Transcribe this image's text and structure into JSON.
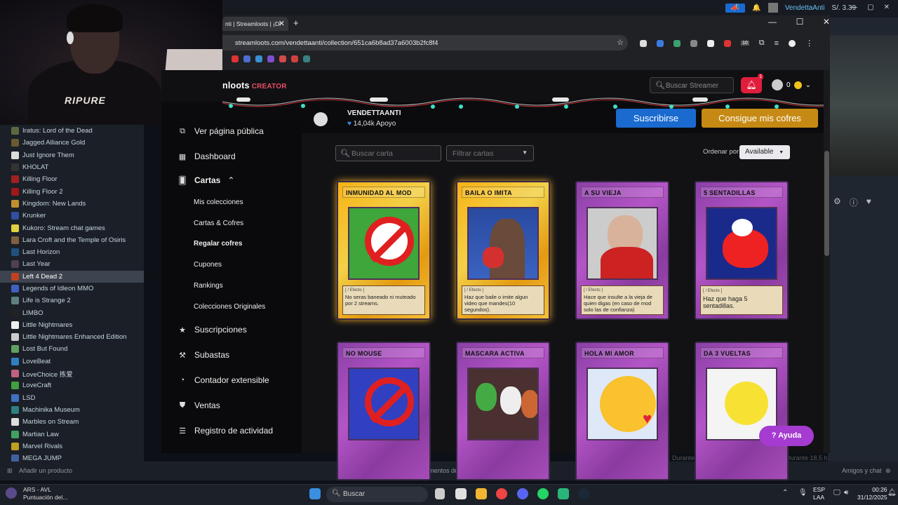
{
  "steam": {
    "username": "VendettaAnti",
    "balance": "S/. 3.39",
    "games": [
      {
        "name": "Iratus: Lord of the Dead",
        "color": "#5a6a40"
      },
      {
        "name": "Jagged Alliance Gold",
        "color": "#6a5a30"
      },
      {
        "name": "Just Ignore Them",
        "color": "#ddd"
      },
      {
        "name": "KHOLAT",
        "color": "#333"
      },
      {
        "name": "Killing Floor",
        "color": "#a02020"
      },
      {
        "name": "Killing Floor 2",
        "color": "#a01818"
      },
      {
        "name": "Kingdom: New Lands",
        "color": "#c09030"
      },
      {
        "name": "Krunker",
        "color": "#3050a0"
      },
      {
        "name": "Kukoro: Stream chat games",
        "color": "#e0d040"
      },
      {
        "name": "Lara Croft and the Temple of Osiris",
        "color": "#806040"
      },
      {
        "name": "Last Horizon",
        "color": "#205080"
      },
      {
        "name": "Last Year",
        "color": "#504050"
      },
      {
        "name": "Left 4 Dead 2",
        "color": "#c04020"
      },
      {
        "name": "Legends of Idleon MMO",
        "color": "#4060c0"
      },
      {
        "name": "Life is Strange 2",
        "color": "#608080"
      },
      {
        "name": "LIMBO",
        "color": "#222"
      },
      {
        "name": "Little Nightmares",
        "color": "#eee"
      },
      {
        "name": "Little Nightmares Enhanced Edition",
        "color": "#ccc"
      },
      {
        "name": "Lost But Found",
        "color": "#60a060"
      },
      {
        "name": "LoveBeat",
        "color": "#3080c0"
      },
      {
        "name": "LoveChoice 拣爱",
        "color": "#c06080"
      },
      {
        "name": "LoveCraft",
        "color": "#40a040"
      },
      {
        "name": "LSD",
        "color": "#4070c0"
      },
      {
        "name": "Machinika Museum",
        "color": "#308080"
      },
      {
        "name": "Marbles on Stream",
        "color": "#ddd"
      },
      {
        "name": "Martian Law",
        "color": "#40a060"
      },
      {
        "name": "Marvel Rivals",
        "color": "#c0a020"
      },
      {
        "name": "MEGA JUMP",
        "color": "#4060a0"
      }
    ],
    "add_product": "Añadir un producto",
    "downloads": "Elementos descargados - 1 de 1",
    "friends_chat": "Amigos y chat",
    "duration_1": "Durante 22,3 h",
    "duration_2": "Durante 18,5 h"
  },
  "browser": {
    "tab_title": "nti | Streamloots | ¡Di",
    "url": "streamloots.com/vendettaanti/collection/651ca6b8ad37a6003b2fc8f4",
    "extension_badge": "10"
  },
  "site": {
    "logo": "nloots",
    "logo_badge": "CREATOR",
    "search_placeholder": "Buscar Streamer",
    "notifications": "1",
    "coins": "0",
    "streamer_name": "VENDETTAANTI",
    "support": "14,04k Apoyo",
    "subscribe": "Suscribirse",
    "get_chests": "Consigue mis cofres",
    "nav": {
      "public_page": "Ver página pública",
      "dashboard": "Dashboard",
      "cards": "Cartas",
      "sub": [
        "Mis colecciones",
        "Cartas & Cofres",
        "Regalar cofres",
        "Cupones",
        "Rankings",
        "Colecciones Originales"
      ],
      "subscriptions": "Suscripciones",
      "auctions": "Subastas",
      "counter": "Contador extensible",
      "sales": "Ventas",
      "activity": "Registro de actividad"
    },
    "search_card": "Buscar carta",
    "filter_cards": "Filtrar cartas",
    "sort_label": "Ordenar por",
    "sort_value": "Available",
    "help": "Ayuda",
    "cards": [
      {
        "title": "INMUNIDAD AL MOD",
        "tag": "[ / Efecto ]",
        "desc": "No seras baneado ni muteado por 2 streams.",
        "style": "gold"
      },
      {
        "title": "BAILA O IMITA",
        "tag": "[ / Efecto ]",
        "desc": "Haz que baile o imite algun video que mandes(10 segundos).",
        "style": "gold"
      },
      {
        "title": "A SU VIEJA",
        "tag": "[ / Efecto ]",
        "desc": "Hace que insulte a la vieja de quien digas (en caso de mod solo las de confianza)",
        "style": "purple"
      },
      {
        "title": "5 SENTADILLAS",
        "tag": "[ / Efecto ]",
        "desc": "Haz que haga 5 sentadillas.",
        "style": "purple"
      },
      {
        "title": "NO MOUSE",
        "tag": "",
        "desc": "",
        "style": "purple"
      },
      {
        "title": "MASCARA ACTIVA",
        "tag": "",
        "desc": "",
        "style": "purple"
      },
      {
        "title": "HOLA MI AMOR",
        "tag": "",
        "desc": "",
        "style": "purple"
      },
      {
        "title": "DA 3 VUELTAS",
        "tag": "",
        "desc": "",
        "style": "purple"
      }
    ]
  },
  "taskbar": {
    "weather_title": "ARS - AVL",
    "weather_sub": "Puntuación del...",
    "search": "Buscar",
    "lang1": "ESP",
    "lang2": "LAA",
    "time": "00:26",
    "date": "31/12/2025"
  }
}
